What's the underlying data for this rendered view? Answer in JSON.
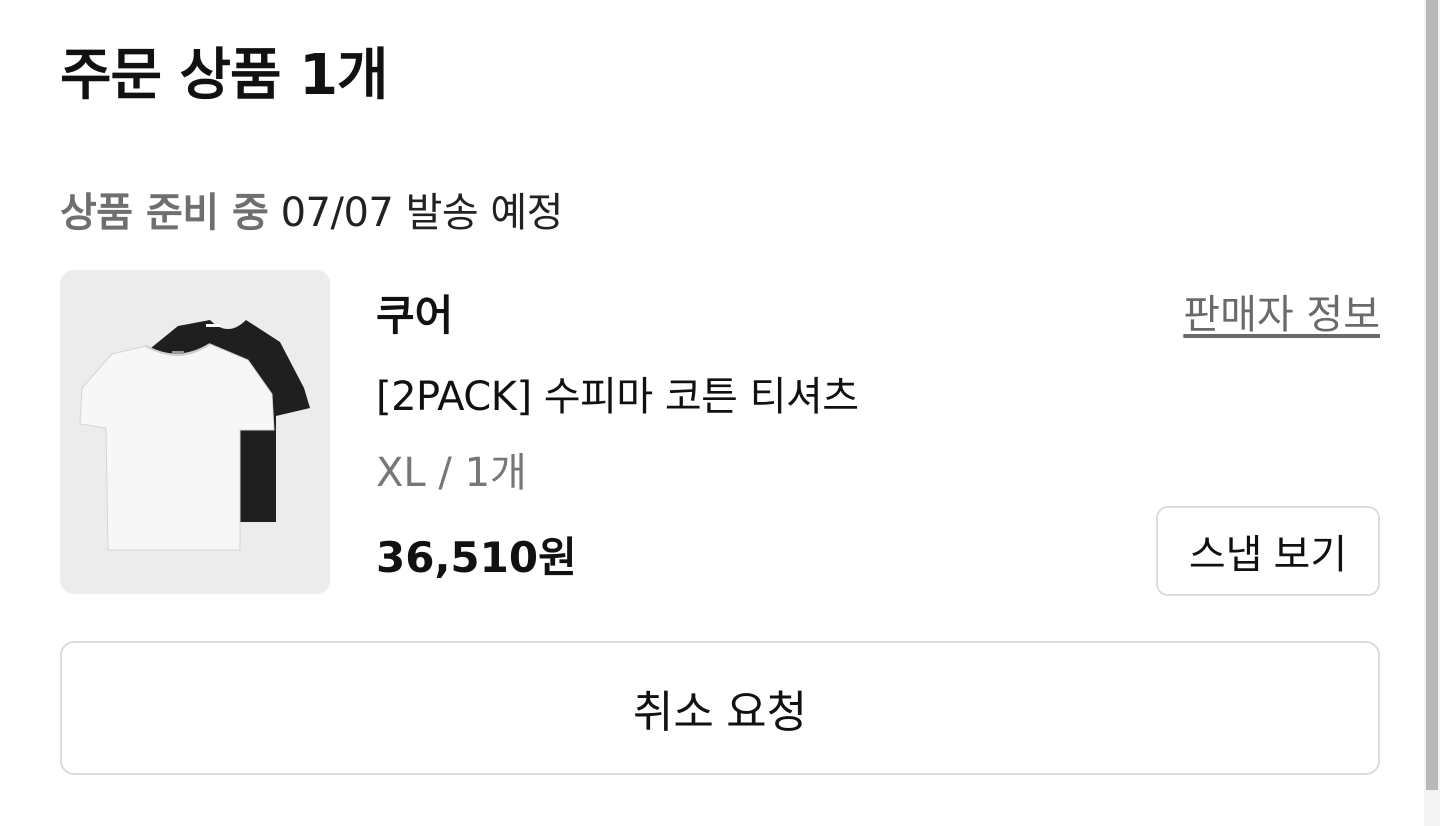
{
  "order": {
    "title": "주문 상품 1개",
    "status": "상품 준비 중",
    "shipping": "07/07 발송 예정"
  },
  "product": {
    "image_icon": "tshirt-2pack-image",
    "brand": "쿠어",
    "seller_info_label": "판매자 정보",
    "name": "[2PACK] 수피마 코튼 티셔츠",
    "option": "XL / 1개",
    "price": "36,510원",
    "snap_label": "스냅 보기"
  },
  "actions": {
    "cancel_label": "취소 요청"
  },
  "colors": {
    "border": "#dcdcdc",
    "thumb_bg": "#ececec",
    "muted_text": "#6f6f6f"
  }
}
